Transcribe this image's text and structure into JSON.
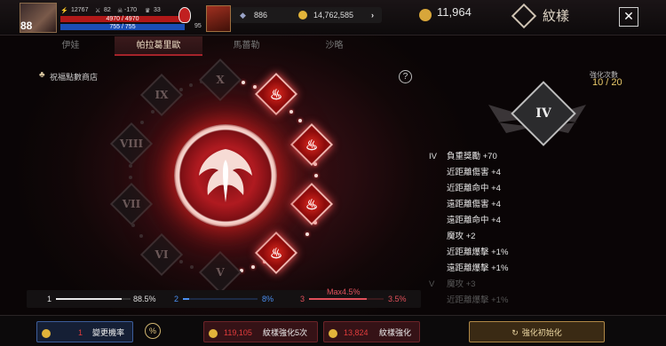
{
  "player": {
    "level": "88",
    "stat1": "12767",
    "stat2": "82",
    "stat3": "-170",
    "stat4": "33",
    "hp": "4970 / 4970",
    "mp": "755 / 755",
    "potion_count": "95"
  },
  "currency": {
    "diamonds": "886",
    "gold": "14,762,585",
    "points": "11,964"
  },
  "header": {
    "title": "紋樣",
    "close_label": "✕"
  },
  "tabs": [
    {
      "label": "伊娃"
    },
    {
      "label": "帕拉葛里歐"
    },
    {
      "label": "馬薔勒"
    },
    {
      "label": "沙略"
    }
  ],
  "shop_label": "祝福點數商店",
  "help_label": "?",
  "enhance": {
    "label": "強化次數",
    "count": "10 / 20"
  },
  "nodes": [
    {
      "label": "X"
    },
    {
      "label": "IX"
    },
    {
      "label": "VIII"
    },
    {
      "label": "VII"
    },
    {
      "label": "VI"
    },
    {
      "label": "V"
    }
  ],
  "emblem": {
    "tier": "IV"
  },
  "stats": [
    {
      "tier": "IV",
      "text": "負重獎勵 +70",
      "dim": false
    },
    {
      "tier": "",
      "text": "近距離傷害 +4",
      "dim": false
    },
    {
      "tier": "",
      "text": "近距離命中 +4",
      "dim": false
    },
    {
      "tier": "",
      "text": "遠距離傷害 +4",
      "dim": false
    },
    {
      "tier": "",
      "text": "遠距離命中 +4",
      "dim": false
    },
    {
      "tier": "",
      "text": "魔攻 +2",
      "dim": false
    },
    {
      "tier": "",
      "text": "近距離爆擊 +1%",
      "dim": false
    },
    {
      "tier": "",
      "text": "遠距離爆擊 +1%",
      "dim": false
    },
    {
      "tier": "V",
      "text": "魔攻 +3",
      "dim": true
    },
    {
      "tier": "",
      "text": "近距離爆擊 +1%",
      "dim": true
    }
  ],
  "rates": {
    "r1_label": "1",
    "r1_value": "88.5%",
    "r2_label": "2",
    "r2_value": "8%",
    "r3_label": "3",
    "r3_value": "3.5%",
    "max_label": "Max4.5%",
    "r1_fill": 0.885,
    "r2_fill": 0.08,
    "r3_fill": 0.035
  },
  "buttons": {
    "rate_count": "1",
    "rate_label": "變更機率",
    "pct_label": "%",
    "five_cost": "119,105",
    "five_label": "紋樣強化5次",
    "one_cost": "13,824",
    "one_label": "紋樣強化",
    "reset_label": "強化初始化"
  },
  "colors": {
    "accent": "#a5232a",
    "gold": "#e9c96a",
    "hp": "#b01818",
    "mp": "#1b4eb5"
  }
}
